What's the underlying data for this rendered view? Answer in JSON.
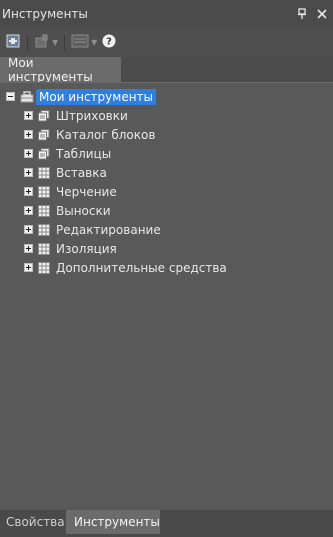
{
  "panel": {
    "title": "Инструменты"
  },
  "titlebar_controls": [
    {
      "icon": "pin-icon",
      "glyph": "⊥"
    },
    {
      "icon": "close-icon",
      "glyph": "✕"
    }
  ],
  "toolbar": {
    "buttons": [
      {
        "icon": "palette-icon"
      },
      {
        "icon": "tool-properties-icon"
      },
      {
        "icon": "view-options-icon"
      },
      {
        "icon": "help-icon",
        "glyph": "?"
      }
    ]
  },
  "tabs_top": [
    {
      "label": "Мои инструменты"
    }
  ],
  "tree": {
    "root": {
      "label": "Мои инструменты",
      "icon": "toolbox-icon",
      "expanded": true
    },
    "children": [
      {
        "label": "Штриховки",
        "icon": "palette-icon"
      },
      {
        "label": "Каталог блоков",
        "icon": "palette-icon"
      },
      {
        "label": "Таблицы",
        "icon": "palette-icon"
      },
      {
        "label": "Вставка",
        "icon": "grid-icon"
      },
      {
        "label": "Черчение",
        "icon": "grid-icon"
      },
      {
        "label": "Выноски",
        "icon": "grid-icon"
      },
      {
        "label": "Редактирование",
        "icon": "grid-icon"
      },
      {
        "label": "Изоляция",
        "icon": "grid-icon"
      },
      {
        "label": "Дополнительные средства",
        "icon": "grid-icon"
      }
    ]
  },
  "bottom_tabs": [
    {
      "label": "Свойства",
      "active": false
    },
    {
      "label": "Инструменты",
      "active": true
    }
  ],
  "colors": {
    "selection": "#2f7fe0",
    "panel_bg": "#595959"
  }
}
